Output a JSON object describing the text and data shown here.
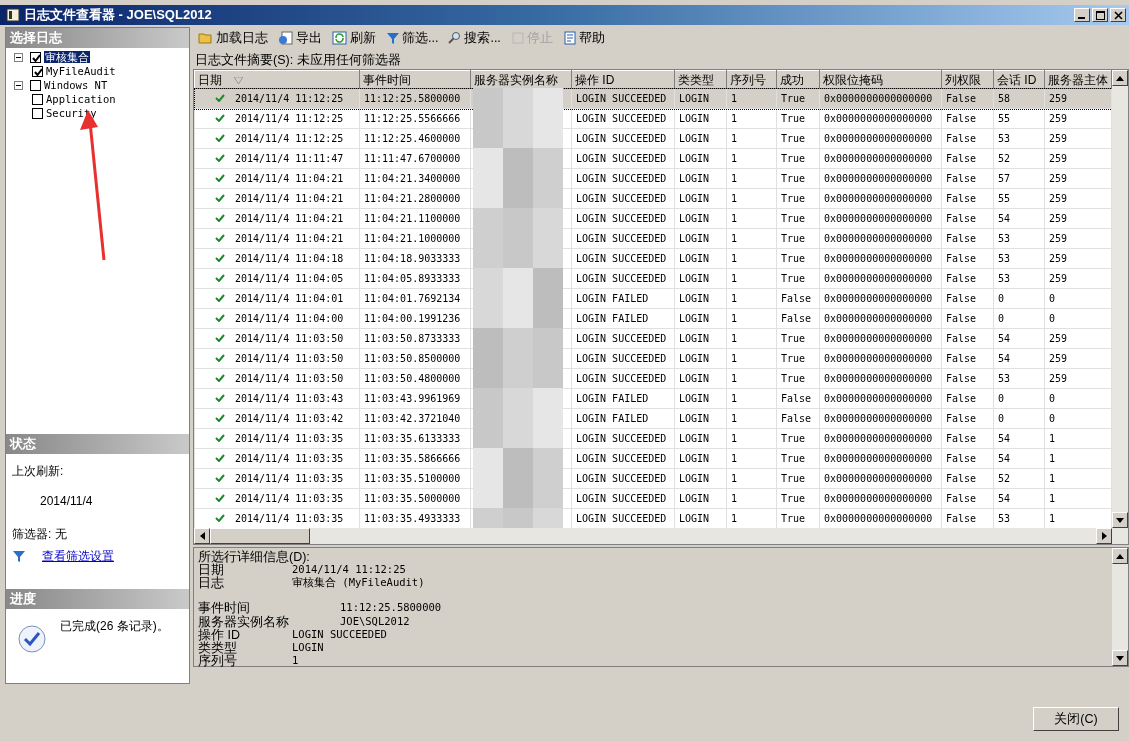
{
  "window": {
    "title": "日志文件查看器 - JOE\\SQL2012"
  },
  "log_select": {
    "header": "选择日志",
    "tree": [
      {
        "label": "审核集合",
        "checked": true,
        "selected": true,
        "expanded": true,
        "children": [
          {
            "label": "MyFileAudit",
            "checked": true,
            "selected": false
          }
        ]
      },
      {
        "label": "Windows NT",
        "checked": false,
        "selected": false,
        "expanded": true,
        "children": [
          {
            "label": "Application",
            "checked": false,
            "selected": false
          },
          {
            "label": "Security",
            "checked": false,
            "selected": false
          }
        ]
      }
    ]
  },
  "status": {
    "header": "状态",
    "last_refresh_label": "上次刷新:",
    "last_refresh": "2014/11/4",
    "filter": "筛选器: 无",
    "filter_link": "查看筛选设置"
  },
  "progress": {
    "header": "进度",
    "message": "已完成(26 条记录)。"
  },
  "toolbar": [
    {
      "kind": "load",
      "label": "加载日志",
      "disabled": false
    },
    {
      "kind": "export",
      "label": "导出",
      "disabled": false
    },
    {
      "kind": "refresh",
      "label": "刷新",
      "disabled": false
    },
    {
      "kind": "filter",
      "label": "筛选...",
      "disabled": false
    },
    {
      "kind": "search",
      "label": "搜索...",
      "disabled": false
    },
    {
      "kind": "stop",
      "label": "停止",
      "disabled": true
    },
    {
      "kind": "help",
      "label": "帮助",
      "disabled": false
    }
  ],
  "summary": "日志文件摘要(S): 未应用任何筛选器",
  "table": {
    "columns": [
      "日期",
      "事件时间",
      "服务器实例名称",
      "操作 ID",
      "类类型",
      "序列号",
      "成功",
      "权限位掩码",
      "列权限",
      "会话 ID",
      "服务器主体"
    ],
    "rows": [
      {
        "selected": true,
        "cells": [
          "2014/11/4 11:12:25",
          "11:12:25.5800000",
          "",
          "LOGIN SUCCEEDED",
          "LOGIN",
          "1",
          "True",
          "0x0000000000000000",
          "False",
          "58",
          "259"
        ]
      },
      {
        "selected": false,
        "cells": [
          "2014/11/4 11:12:25",
          "11:12:25.5566666",
          "",
          "LOGIN SUCCEEDED",
          "LOGIN",
          "1",
          "True",
          "0x0000000000000000",
          "False",
          "55",
          "259"
        ]
      },
      {
        "selected": false,
        "cells": [
          "2014/11/4 11:12:25",
          "11:12:25.4600000",
          "",
          "LOGIN SUCCEEDED",
          "LOGIN",
          "1",
          "True",
          "0x0000000000000000",
          "False",
          "53",
          "259"
        ]
      },
      {
        "selected": false,
        "cells": [
          "2014/11/4 11:11:47",
          "11:11:47.6700000",
          "",
          "LOGIN SUCCEEDED",
          "LOGIN",
          "1",
          "True",
          "0x0000000000000000",
          "False",
          "52",
          "259"
        ]
      },
      {
        "selected": false,
        "cells": [
          "2014/11/4 11:04:21",
          "11:04:21.3400000",
          "",
          "LOGIN SUCCEEDED",
          "LOGIN",
          "1",
          "True",
          "0x0000000000000000",
          "False",
          "57",
          "259"
        ]
      },
      {
        "selected": false,
        "cells": [
          "2014/11/4 11:04:21",
          "11:04:21.2800000",
          "",
          "LOGIN SUCCEEDED",
          "LOGIN",
          "1",
          "True",
          "0x0000000000000000",
          "False",
          "55",
          "259"
        ]
      },
      {
        "selected": false,
        "cells": [
          "2014/11/4 11:04:21",
          "11:04:21.1100000",
          "",
          "LOGIN SUCCEEDED",
          "LOGIN",
          "1",
          "True",
          "0x0000000000000000",
          "False",
          "54",
          "259"
        ]
      },
      {
        "selected": false,
        "cells": [
          "2014/11/4 11:04:21",
          "11:04:21.1000000",
          "",
          "LOGIN SUCCEEDED",
          "LOGIN",
          "1",
          "True",
          "0x0000000000000000",
          "False",
          "53",
          "259"
        ]
      },
      {
        "selected": false,
        "cells": [
          "2014/11/4 11:04:18",
          "11:04:18.9033333",
          "",
          "LOGIN SUCCEEDED",
          "LOGIN",
          "1",
          "True",
          "0x0000000000000000",
          "False",
          "53",
          "259"
        ]
      },
      {
        "selected": false,
        "cells": [
          "2014/11/4 11:04:05",
          "11:04:05.8933333",
          "",
          "LOGIN SUCCEEDED",
          "LOGIN",
          "1",
          "True",
          "0x0000000000000000",
          "False",
          "53",
          "259"
        ]
      },
      {
        "selected": false,
        "cells": [
          "2014/11/4 11:04:01",
          "11:04:01.7692134",
          "",
          "LOGIN FAILED",
          "LOGIN",
          "1",
          "False",
          "0x0000000000000000",
          "False",
          "0",
          "0"
        ]
      },
      {
        "selected": false,
        "cells": [
          "2014/11/4 11:04:00",
          "11:04:00.1991236",
          "",
          "LOGIN FAILED",
          "LOGIN",
          "1",
          "False",
          "0x0000000000000000",
          "False",
          "0",
          "0"
        ]
      },
      {
        "selected": false,
        "cells": [
          "2014/11/4 11:03:50",
          "11:03:50.8733333",
          "",
          "LOGIN SUCCEEDED",
          "LOGIN",
          "1",
          "True",
          "0x0000000000000000",
          "False",
          "54",
          "259"
        ]
      },
      {
        "selected": false,
        "cells": [
          "2014/11/4 11:03:50",
          "11:03:50.8500000",
          "",
          "LOGIN SUCCEEDED",
          "LOGIN",
          "1",
          "True",
          "0x0000000000000000",
          "False",
          "54",
          "259"
        ]
      },
      {
        "selected": false,
        "cells": [
          "2014/11/4 11:03:50",
          "11:03:50.4800000",
          "",
          "LOGIN SUCCEEDED",
          "LOGIN",
          "1",
          "True",
          "0x0000000000000000",
          "False",
          "53",
          "259"
        ]
      },
      {
        "selected": false,
        "cells": [
          "2014/11/4 11:03:43",
          "11:03:43.9961969",
          "",
          "LOGIN FAILED",
          "LOGIN",
          "1",
          "False",
          "0x0000000000000000",
          "False",
          "0",
          "0"
        ]
      },
      {
        "selected": false,
        "cells": [
          "2014/11/4 11:03:42",
          "11:03:42.3721040",
          "",
          "LOGIN FAILED",
          "LOGIN",
          "1",
          "False",
          "0x0000000000000000",
          "False",
          "0",
          "0"
        ]
      },
      {
        "selected": false,
        "cells": [
          "2014/11/4 11:03:35",
          "11:03:35.6133333",
          "",
          "LOGIN SUCCEEDED",
          "LOGIN",
          "1",
          "True",
          "0x0000000000000000",
          "False",
          "54",
          "1"
        ]
      },
      {
        "selected": false,
        "cells": [
          "2014/11/4 11:03:35",
          "11:03:35.5866666",
          "",
          "LOGIN SUCCEEDED",
          "LOGIN",
          "1",
          "True",
          "0x0000000000000000",
          "False",
          "54",
          "1"
        ]
      },
      {
        "selected": false,
        "cells": [
          "2014/11/4 11:03:35",
          "11:03:35.5100000",
          "",
          "LOGIN SUCCEEDED",
          "LOGIN",
          "1",
          "True",
          "0x0000000000000000",
          "False",
          "52",
          "1"
        ]
      },
      {
        "selected": false,
        "cells": [
          "2014/11/4 11:03:35",
          "11:03:35.5000000",
          "",
          "LOGIN SUCCEEDED",
          "LOGIN",
          "1",
          "True",
          "0x0000000000000000",
          "False",
          "54",
          "1"
        ]
      },
      {
        "selected": false,
        "cells": [
          "2014/11/4 11:03:35",
          "11:03:35.4933333",
          "",
          "LOGIN SUCCEEDED",
          "LOGIN",
          "1",
          "True",
          "0x0000000000000000",
          "False",
          "53",
          "1"
        ]
      }
    ]
  },
  "details": {
    "header": "所选行详细信息(D):",
    "groups": [
      [
        {
          "label": "日期",
          "value": "2014/11/4 11:12:25"
        },
        {
          "label": "日志",
          "value": "审核集合 (MyFileAudit)"
        }
      ],
      [
        {
          "label": "事件时间",
          "value": "11:12:25.5800000"
        },
        {
          "label": "服务器实例名称",
          "value": "JOE\\SQL2012"
        }
      ],
      [
        {
          "label": "操作 ID",
          "value": "LOGIN SUCCEEDED"
        },
        {
          "label": "类类型",
          "value": "LOGIN"
        },
        {
          "label": "序列号",
          "value": "1"
        }
      ]
    ]
  },
  "close_button": "关闭(C)"
}
